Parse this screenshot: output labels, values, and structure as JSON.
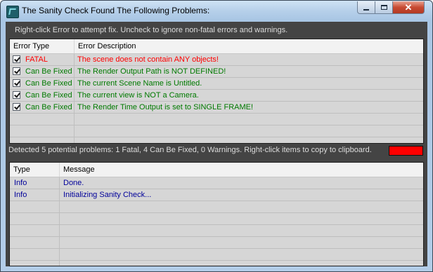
{
  "window": {
    "title": "The Sanity Check Found The Following Problems:",
    "icon": "3ds-max-app-icon"
  },
  "hint": "Right-click Error to attempt fix. Uncheck to ignore non-fatal errors and warnings.",
  "errors_table": {
    "columns": [
      "Error Type",
      "Error Description"
    ],
    "rows": [
      {
        "checked": true,
        "type": "FATAL",
        "description": "The scene does not contain ANY objects!",
        "color": "#ff0000"
      },
      {
        "checked": true,
        "type": "Can Be Fixed",
        "description": "The Render Output Path is NOT DEFINED!",
        "color": "#007a00"
      },
      {
        "checked": true,
        "type": "Can Be Fixed",
        "description": "The current Scene Name is Untitled.",
        "color": "#007a00"
      },
      {
        "checked": true,
        "type": "Can Be Fixed",
        "description": "The current view is NOT a Camera.",
        "color": "#007a00"
      },
      {
        "checked": true,
        "type": "Can Be Fixed",
        "description": "The Render Time Output is set to SINGLE FRAME!",
        "color": "#007a00"
      },
      {
        "checked": false,
        "type": "",
        "description": "",
        "color": "#000000"
      },
      {
        "checked": false,
        "type": "",
        "description": "",
        "color": "#000000"
      }
    ]
  },
  "status": {
    "text": "Detected 5 potential problems: 1 Fatal, 4 Can Be Fixed, 0 Warnings. Right-click items to copy to clipboard.",
    "indicator_color": "#ff0000"
  },
  "log_table": {
    "columns": [
      "Type",
      "Message"
    ],
    "rows": [
      {
        "type": "Info",
        "message": "Done.",
        "color": "#00009a"
      },
      {
        "type": "Info",
        "message": "Initializing Sanity Check...",
        "color": "#00009a"
      },
      {
        "type": "",
        "message": "",
        "color": "#000000"
      },
      {
        "type": "",
        "message": "",
        "color": "#000000"
      },
      {
        "type": "",
        "message": "",
        "color": "#000000"
      },
      {
        "type": "",
        "message": "",
        "color": "#000000"
      },
      {
        "type": "",
        "message": "",
        "color": "#000000"
      }
    ]
  }
}
